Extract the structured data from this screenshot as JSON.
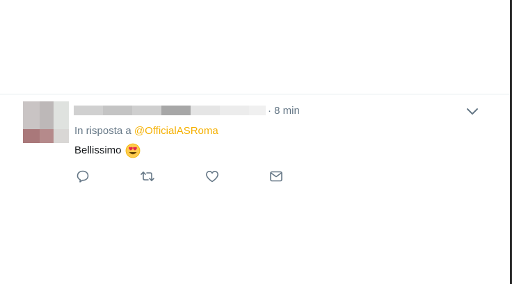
{
  "tweet": {
    "time": "· 8 min",
    "reply_prefix": "In risposta a",
    "reply_handle": "@OfficialASRoma",
    "text": "Bellissimo",
    "emoji": "smiling-face-with-heart-eyes"
  },
  "icons": {
    "caret": "chevron-down-icon",
    "reply": "reply-icon",
    "retweet": "retweet-icon",
    "like": "heart-icon",
    "dm": "envelope-icon"
  },
  "colors": {
    "secondary_text": "#657786",
    "handle_link": "#f5b000",
    "body_text": "#14171a",
    "divider": "#e6ecf0"
  }
}
